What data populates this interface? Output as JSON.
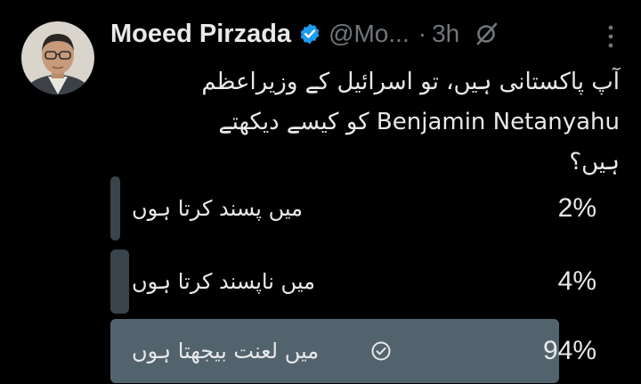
{
  "author": {
    "name": "Moeed Pirzada",
    "handle": "@Mo...",
    "separator": "·",
    "time": "3h",
    "avatar_icon": "person-avatar",
    "verified_icon": "verified-badge-icon",
    "verified_color": "#1d9bf0"
  },
  "tweet": {
    "lines": [
      "آپ پاکستانی ہیں، تو اسرائیل کے وزیراعظم",
      "Benjamin Netanyahu کو کیسے دیکھتے",
      "ہیں؟"
    ]
  },
  "poll": {
    "options": [
      {
        "label": "میں پسند کرتا ہوں",
        "percent_label": "2%",
        "percent": 2,
        "selected": false
      },
      {
        "label": "میں ناپسند کرتا ہوں",
        "percent_label": "4%",
        "percent": 4,
        "selected": false
      },
      {
        "label": "میں لعنت بیجھتا ہوں",
        "percent_label": "94%",
        "percent": 94,
        "selected": true
      }
    ],
    "colors": {
      "bar": "#3a444c",
      "winner_bar": "#53636e"
    }
  },
  "colors": {
    "background": "#000000",
    "text": "#e7e9ea",
    "secondary": "#71767b"
  }
}
